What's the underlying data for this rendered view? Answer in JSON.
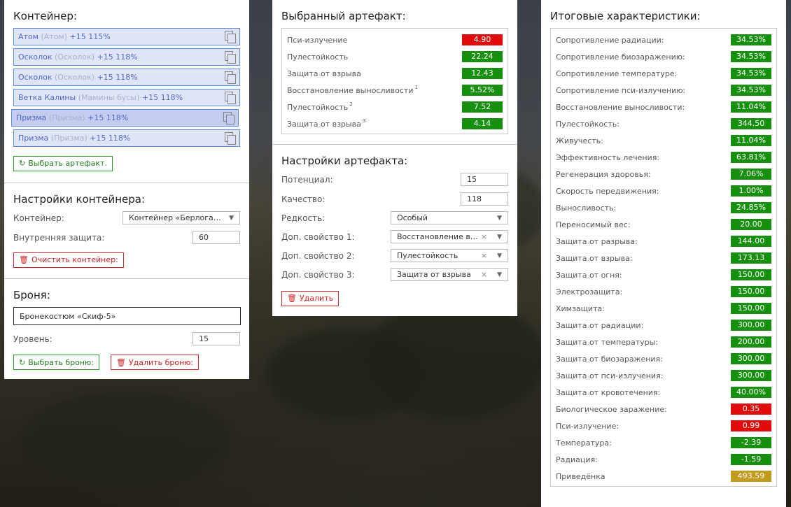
{
  "container": {
    "title": "Контейнер:",
    "items": [
      {
        "name": "Атом",
        "alt": "(Атом)",
        "stats": "+15 115%",
        "selected": false
      },
      {
        "name": "Осколок",
        "alt": "(Осколок)",
        "stats": "+15 118%",
        "selected": false
      },
      {
        "name": "Осколок",
        "alt": "(Осколок)",
        "stats": "+15 118%",
        "selected": false
      },
      {
        "name": "Ветка Калины",
        "alt": "(Мамины бусы)",
        "stats": "+15 118%",
        "selected": false
      },
      {
        "name": "Призма",
        "alt": "(Призма)",
        "stats": "+15 118%",
        "selected": true
      },
      {
        "name": "Призма",
        "alt": "(Призма)",
        "stats": "+15 118%",
        "selected": false
      }
    ],
    "choose_btn": "Выбрать артефакт."
  },
  "container_settings": {
    "title": "Настройки контейнера:",
    "container_label": "Контейнер:",
    "container_value": "Контейнер «Берлога…",
    "protection_label": "Внутренняя защита:",
    "protection_value": "60",
    "clear_btn": "Очистить контейнер:"
  },
  "armor": {
    "title": "Броня:",
    "value": "Бронекостюм «Скиф-5»",
    "level_label": "Уровень:",
    "level_value": "15",
    "choose_btn": "Выбрать броню:",
    "delete_btn": "Удалить броню:"
  },
  "selected_artifact": {
    "title": "Выбранный артефакт:",
    "stats": [
      {
        "label": "Пси-излучение",
        "sup": "",
        "value": "4.90",
        "color": "r"
      },
      {
        "label": "Пулестойкость",
        "sup": "",
        "value": "22.24",
        "color": "g"
      },
      {
        "label": "Защита от взрыва",
        "sup": "",
        "value": "12.43",
        "color": "g"
      },
      {
        "label": "Восстановление выносливости",
        "sup": "1",
        "value": "5.52%",
        "color": "g"
      },
      {
        "label": "Пулестойкость",
        "sup": "2",
        "value": "7.52",
        "color": "g"
      },
      {
        "label": "Защита от взрыва",
        "sup": "3",
        "value": "4.14",
        "color": "g"
      }
    ]
  },
  "artifact_settings": {
    "title": "Настройки артефакта:",
    "potential_label": "Потенциал:",
    "potential_value": "15",
    "quality_label": "Качество:",
    "quality_value": "118",
    "rarity_label": "Редкость:",
    "rarity_value": "Особый",
    "extra1_label": "Доп. свойство 1:",
    "extra1_value": "Восстановление в…",
    "extra2_label": "Доп. свойство 2:",
    "extra2_value": "Пулестойкость",
    "extra3_label": "Доп. свойство 3:",
    "extra3_value": "Защита от взрыва",
    "delete_btn": "Удалить"
  },
  "totals": {
    "title": "Итоговые характеристики:",
    "stats": [
      {
        "label": "Сопротивление радиации:",
        "value": "34.53%",
        "color": "g"
      },
      {
        "label": "Сопротивление биозаражению:",
        "value": "34.53%",
        "color": "g"
      },
      {
        "label": "Сопротивление температуре:",
        "value": "34.53%",
        "color": "g"
      },
      {
        "label": "Сопротивление пси-излучению:",
        "value": "34.53%",
        "color": "g"
      },
      {
        "label": "Восстановление выносливости:",
        "value": "11.04%",
        "color": "g"
      },
      {
        "label": "Пулестойкость:",
        "value": "344.50",
        "color": "g"
      },
      {
        "label": "Живучесть:",
        "value": "11.04%",
        "color": "g"
      },
      {
        "label": "Эффективность лечения:",
        "value": "63.81%",
        "color": "g"
      },
      {
        "label": "Регенерация здоровья:",
        "value": "7.06%",
        "color": "g"
      },
      {
        "label": "Скорость передвижения:",
        "value": "1.00%",
        "color": "g"
      },
      {
        "label": "Выносливость:",
        "value": "24.85%",
        "color": "g"
      },
      {
        "label": "Переносимый вес:",
        "value": "20.00",
        "color": "g"
      },
      {
        "label": "Защита от разрыва:",
        "value": "144.00",
        "color": "g"
      },
      {
        "label": "Защита от взрыва:",
        "value": "173.13",
        "color": "g"
      },
      {
        "label": "Защита от огня:",
        "value": "150.00",
        "color": "g"
      },
      {
        "label": "Электрозащита:",
        "value": "150.00",
        "color": "g"
      },
      {
        "label": "Химзащита:",
        "value": "150.00",
        "color": "g"
      },
      {
        "label": "Защита от радиации:",
        "value": "300.00",
        "color": "g"
      },
      {
        "label": "Защита от температуры:",
        "value": "200.00",
        "color": "g"
      },
      {
        "label": "Защита от биозаражения:",
        "value": "300.00",
        "color": "g"
      },
      {
        "label": "Защита от пси-излучения:",
        "value": "300.00",
        "color": "g"
      },
      {
        "label": "Защита от кровотечения:",
        "value": "40.00%",
        "color": "g"
      },
      {
        "label": "Биологическое заражение:",
        "value": "0.35",
        "color": "r"
      },
      {
        "label": "Пси-излучение:",
        "value": "0.99",
        "color": "r"
      },
      {
        "label": "Температура:",
        "value": "-2.39",
        "color": "g"
      },
      {
        "label": "Радиация:",
        "value": "-1.59",
        "color": "g"
      },
      {
        "label": "Приведёнка",
        "value": "493.59",
        "color": "y"
      }
    ]
  }
}
